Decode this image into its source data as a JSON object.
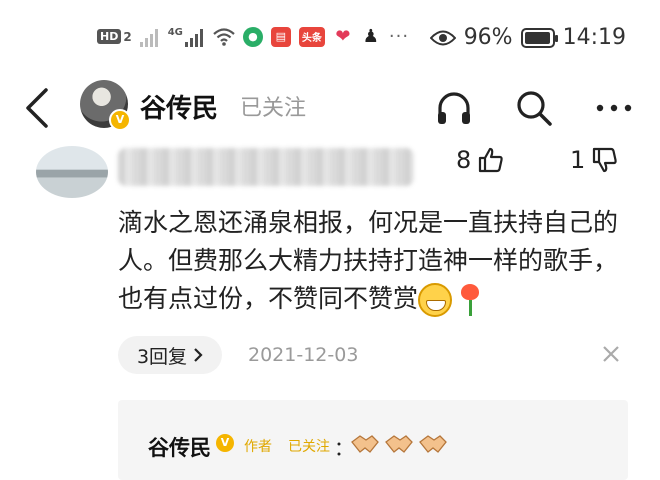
{
  "status_bar": {
    "hd": "HD",
    "sim": "2",
    "net": "4G",
    "app_icons": [
      {
        "name": "wechat-icon",
        "color": "#2aae67"
      },
      {
        "name": "books-icon",
        "color": "#e8453c"
      },
      {
        "name": "toutiao-icon",
        "color": "#e8453c",
        "label": "头条"
      },
      {
        "name": "heart-app-icon",
        "color": "#e33b5a"
      },
      {
        "name": "qq-icon",
        "color": "#222222"
      }
    ],
    "eye_icon": "eye-icon",
    "battery": "96%",
    "battery_level": 0.96,
    "time": "14:19"
  },
  "nav": {
    "username": "谷传民",
    "follow_status": "已关注",
    "verified_mark": "V"
  },
  "comment": {
    "likes": "8",
    "dislikes": "1",
    "text": "滴水之恩还涌泉相报，何况是一直扶持自己的人。但费那么大精力扶持打造神一样的歌手，也有点过份，不赞同不赞赏",
    "reply_count": "3回复",
    "date": "2021-12-03"
  },
  "sub_reply": {
    "name": "谷传民",
    "verified_mark": "V",
    "author_tag": "作者",
    "follow_tag": "已关注",
    "colon": "："
  },
  "colors": {
    "accent_gold": "#f5b500",
    "muted": "#999999"
  }
}
